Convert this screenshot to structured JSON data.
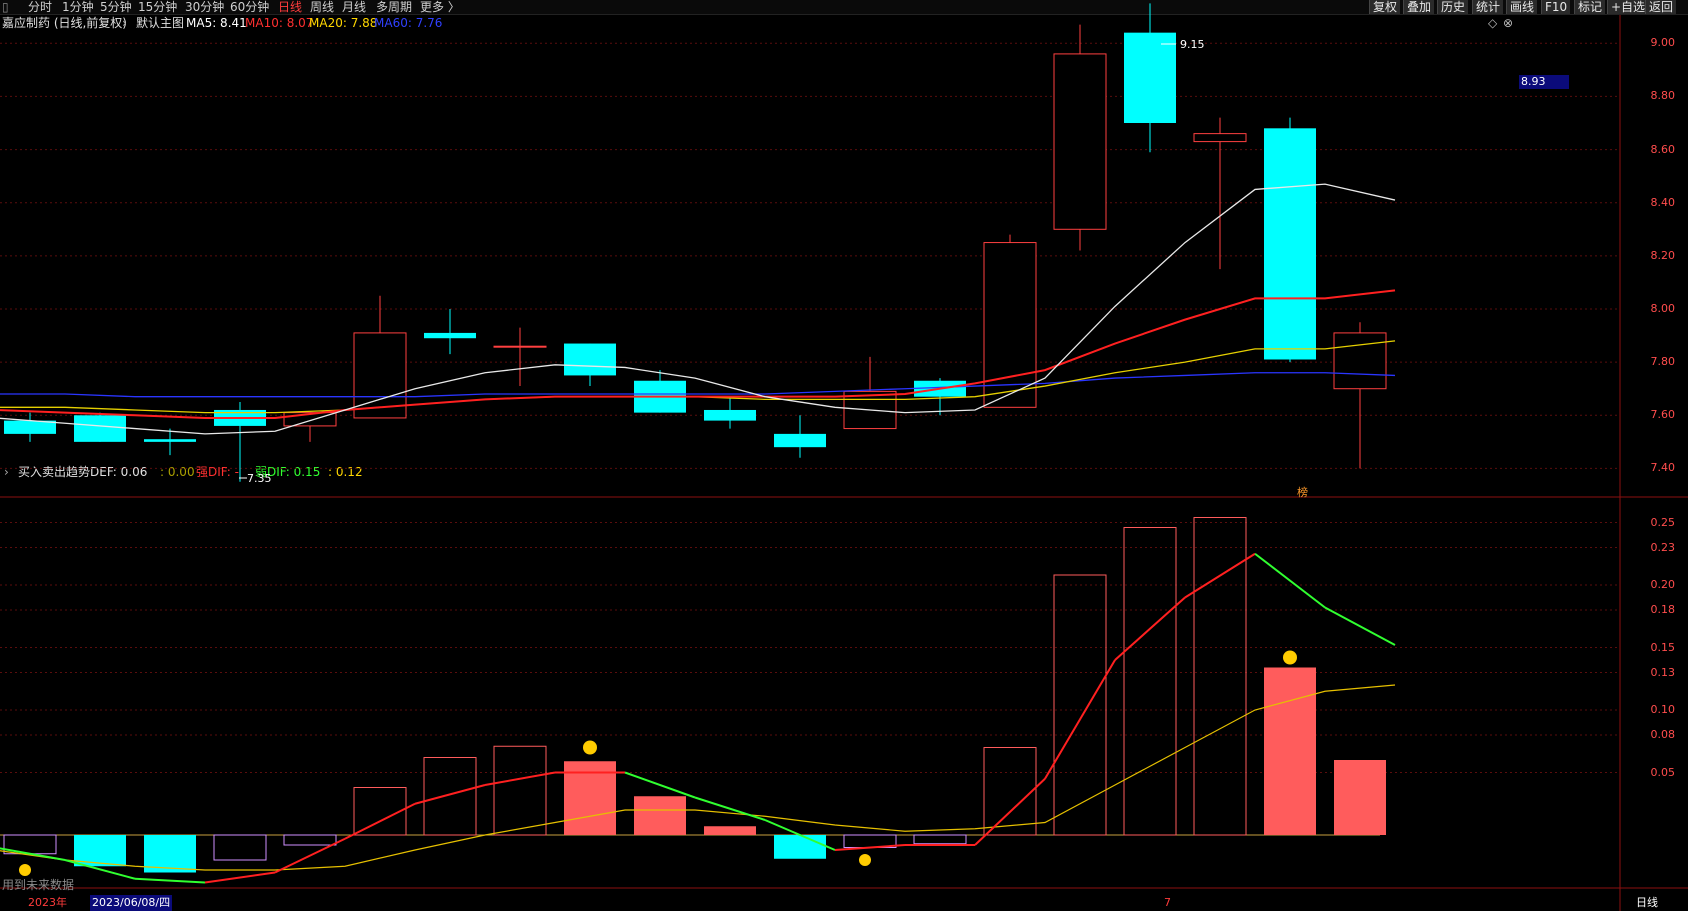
{
  "toolbar": {
    "periods": [
      "分时",
      "1分钟",
      "5分钟",
      "15分钟",
      "30分钟",
      "60分钟",
      "日线",
      "周线",
      "月线",
      "多周期",
      "更多 〉"
    ],
    "active_period": "日线",
    "actions": [
      "复权",
      "叠加",
      "历史",
      "统计",
      "画线",
      "F10",
      "标记",
      "+自选",
      "返回"
    ]
  },
  "main_info": {
    "stock": "嘉应制药 (日线,前复权)",
    "indicator": "默认主图",
    "ma5": "MA5: 8.41",
    "ma10": "MA10: 8.07",
    "ma20": "MA20: 7.88",
    "ma60": "MA60: 7.76",
    "colors": {
      "ma5": "#ffffff",
      "ma10": "#ff3030",
      "ma20": "#ffd700",
      "ma60": "#3040ff"
    }
  },
  "sub_info": {
    "indicator": "买入卖出趋势",
    "def": "DEF: 0.06",
    "zero": ": 0.00",
    "strong": "强DIF: -",
    "weak": "弱DIF: 0.15",
    "last": ": 0.12"
  },
  "price_axis": {
    "labels": [
      "9.00",
      "8.80",
      "8.60",
      "8.40",
      "8.20",
      "8.00",
      "7.80",
      "7.60",
      "7.40"
    ],
    "current": "8.93"
  },
  "sub_axis": {
    "labels": [
      "0.25",
      "0.23",
      "0.20",
      "0.18",
      "0.15",
      "0.13",
      "0.10",
      "0.08",
      "0.05"
    ]
  },
  "annotations": {
    "high": "9.15",
    "low": "7.35",
    "marker_bang": "榜",
    "future_data": "用到未来数据"
  },
  "bottom": {
    "year": "2023年",
    "date": "2023/06/08/四",
    "month_mark": "7",
    "period_btn": "日线"
  },
  "chart_data": {
    "type": "candlestick",
    "candles": [
      {
        "o": 7.58,
        "h": 7.61,
        "l": 7.5,
        "c": 7.53
      },
      {
        "o": 7.6,
        "h": 7.61,
        "l": 7.5,
        "c": 7.5
      },
      {
        "o": 7.51,
        "h": 7.55,
        "l": 7.45,
        "c": 7.5
      },
      {
        "o": 7.62,
        "h": 7.65,
        "l": 7.35,
        "c": 7.56
      },
      {
        "o": 7.56,
        "h": 7.61,
        "l": 7.5,
        "c": 7.61
      },
      {
        "o": 7.59,
        "h": 8.05,
        "l": 7.59,
        "c": 7.91
      },
      {
        "o": 7.91,
        "h": 8.0,
        "l": 7.83,
        "c": 7.89
      },
      {
        "o": 7.86,
        "h": 7.93,
        "l": 7.71,
        "c": 7.86
      },
      {
        "o": 7.87,
        "h": 7.87,
        "l": 7.71,
        "c": 7.75
      },
      {
        "o": 7.73,
        "h": 7.77,
        "l": 7.61,
        "c": 7.61
      },
      {
        "o": 7.62,
        "h": 7.67,
        "l": 7.55,
        "c": 7.58
      },
      {
        "o": 7.53,
        "h": 7.6,
        "l": 7.44,
        "c": 7.48
      },
      {
        "o": 7.55,
        "h": 7.82,
        "l": 7.55,
        "c": 7.69
      },
      {
        "o": 7.73,
        "h": 7.74,
        "l": 7.6,
        "c": 7.67
      },
      {
        "o": 7.63,
        "h": 8.28,
        "l": 7.63,
        "c": 8.25
      },
      {
        "o": 8.3,
        "h": 9.07,
        "l": 8.22,
        "c": 8.96
      },
      {
        "o": 9.04,
        "h": 9.15,
        "l": 8.59,
        "c": 8.7
      },
      {
        "o": 8.63,
        "h": 8.72,
        "l": 8.15,
        "c": 8.66
      },
      {
        "o": 8.68,
        "h": 8.72,
        "l": 7.8,
        "c": 7.81
      },
      {
        "o": 7.7,
        "h": 7.95,
        "l": 7.4,
        "c": 7.91
      }
    ],
    "ma5": [
      7.59,
      7.57,
      7.55,
      7.53,
      7.54,
      7.62,
      7.7,
      7.76,
      7.79,
      7.78,
      7.74,
      7.67,
      7.63,
      7.61,
      7.62,
      7.74,
      8.01,
      8.25,
      8.45,
      8.47,
      8.41
    ],
    "ma10": [
      7.62,
      7.61,
      7.6,
      7.59,
      7.59,
      7.62,
      7.64,
      7.66,
      7.67,
      7.67,
      7.67,
      7.67,
      7.67,
      7.68,
      7.72,
      7.77,
      7.87,
      7.96,
      8.04,
      8.04,
      8.07
    ],
    "ma20": [
      7.63,
      7.63,
      7.62,
      7.61,
      7.61,
      7.62,
      7.64,
      7.66,
      7.67,
      7.67,
      7.67,
      7.66,
      7.66,
      7.66,
      7.67,
      7.71,
      7.76,
      7.8,
      7.85,
      7.85,
      7.88
    ],
    "ma60": [
      7.68,
      7.68,
      7.67,
      7.67,
      7.67,
      7.67,
      7.67,
      7.68,
      7.68,
      7.68,
      7.68,
      7.68,
      7.69,
      7.7,
      7.71,
      7.72,
      7.74,
      7.75,
      7.76,
      7.76,
      7.75
    ],
    "price_ylim": [
      7.3,
      9.05
    ],
    "sub": {
      "bars": [
        -0.015,
        -0.025,
        -0.03,
        -0.02,
        -0.008,
        0.038,
        0.062,
        0.071,
        0.059,
        0.031,
        0.007,
        -0.019,
        -0.01,
        -0.007,
        0.07,
        0.208,
        0.246,
        0.254,
        0.134,
        0.06
      ],
      "bar_kinds": [
        "hollow",
        "cyan",
        "cyan",
        "hollow",
        "hollow",
        "hollow",
        "hollow",
        "hollow",
        "solid",
        "solid",
        "solid",
        "cyan",
        "hollow",
        "hollow",
        "hollow",
        "hollow",
        "hollow",
        "hollow",
        "solid",
        "solid"
      ],
      "dif_line": [
        -0.01,
        -0.02,
        -0.035,
        -0.038,
        -0.03,
        -0.003,
        0.025,
        0.04,
        0.05,
        0.05,
        0.03,
        0.012,
        -0.012,
        -0.008,
        -0.008,
        0.045,
        0.14,
        0.19,
        0.225,
        0.182,
        0.152
      ],
      "dea_line": [
        -0.012,
        -0.02,
        -0.025,
        -0.028,
        -0.028,
        -0.025,
        -0.012,
        0.0,
        0.01,
        0.02,
        0.02,
        0.015,
        0.008,
        0.003,
        0.005,
        0.01,
        0.04,
        0.07,
        0.1,
        0.115,
        0.12
      ],
      "ylim": [
        -0.04,
        0.26
      ]
    }
  }
}
